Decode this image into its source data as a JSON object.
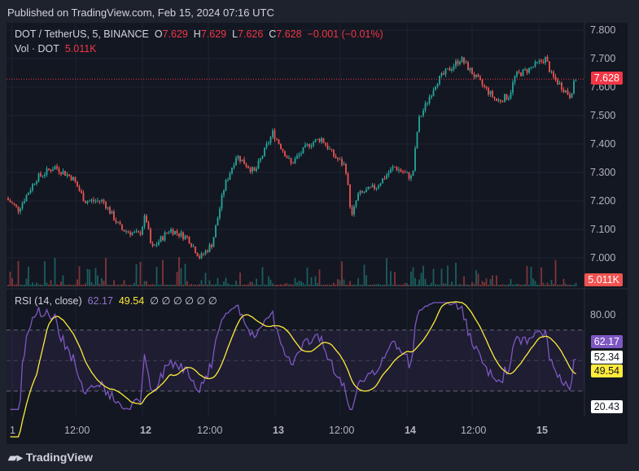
{
  "header": {
    "published": "Published on TradingView.com, Feb 15, 2024 07:16 UTC"
  },
  "legend": {
    "symbol": "DOT / TetherUS, 5, BINANCE",
    "o_label": "O",
    "o": "7.629",
    "h_label": "H",
    "h": "7.629",
    "l_label": "L",
    "l": "7.626",
    "c_label": "C",
    "c": "7.628",
    "change": "−0.001 (−0.01%)",
    "vol_label": "Vol · DOT",
    "vol": "5.011K"
  },
  "rsi_legend": {
    "label": "RSI (14, close)",
    "rsi": "62.17",
    "ma": "49.54",
    "extra": "∅ ∅ ∅ ∅ ∅ ∅"
  },
  "price_axis": [
    "7.800",
    "7.700",
    "7.600",
    "7.500",
    "7.400",
    "7.300",
    "7.200",
    "7.100",
    "7.000"
  ],
  "rsi_axis": [
    "80.00"
  ],
  "tags": {
    "price": "7.628",
    "vol": "5.011K",
    "rsi": "62.17",
    "mid": "52.34",
    "ma": "49.54",
    "low": "20.43"
  },
  "time_axis": [
    "1",
    "12:00",
    "12",
    "12:00",
    "13",
    "12:00",
    "14",
    "12:00",
    "15"
  ],
  "footer": {
    "brand": "TradingView"
  },
  "colors": {
    "up": "#26a69a",
    "down": "#ef5350",
    "rsi": "#7e57c2",
    "ma": "#ffeb3b",
    "bg": "#131722"
  },
  "chart_data": {
    "type": "candlestick",
    "ylim": [
      6.97,
      7.82
    ],
    "rsi_ylim": [
      15,
      90
    ],
    "rsi_bands": [
      30,
      70
    ],
    "price_path": [
      [
        0,
        7.21
      ],
      [
        2,
        7.17
      ],
      [
        5,
        7.28
      ],
      [
        8,
        7.32
      ],
      [
        11,
        7.28
      ],
      [
        13,
        7.2
      ],
      [
        16,
        7.2
      ],
      [
        19,
        7.1
      ],
      [
        22,
        7.08
      ],
      [
        23,
        7.15
      ],
      [
        24,
        7.03
      ],
      [
        27,
        7.1
      ],
      [
        30,
        7.07
      ],
      [
        32,
        7.0
      ],
      [
        34,
        7.05
      ],
      [
        36,
        7.25
      ],
      [
        38,
        7.36
      ],
      [
        41,
        7.3
      ],
      [
        44,
        7.44
      ],
      [
        47,
        7.33
      ],
      [
        50,
        7.4
      ],
      [
        52,
        7.42
      ],
      [
        54,
        7.36
      ],
      [
        56,
        7.32
      ],
      [
        57,
        7.14
      ],
      [
        58,
        7.22
      ],
      [
        61,
        7.25
      ],
      [
        64,
        7.32
      ],
      [
        67,
        7.28
      ],
      [
        68,
        7.48
      ],
      [
        71,
        7.62
      ],
      [
        75,
        7.7
      ],
      [
        78,
        7.62
      ],
      [
        81,
        7.55
      ],
      [
        83,
        7.57
      ],
      [
        84,
        7.64
      ],
      [
        86,
        7.66
      ],
      [
        89,
        7.7
      ],
      [
        90,
        7.64
      ],
      [
        93,
        7.57
      ],
      [
        94,
        7.63
      ]
    ]
  }
}
